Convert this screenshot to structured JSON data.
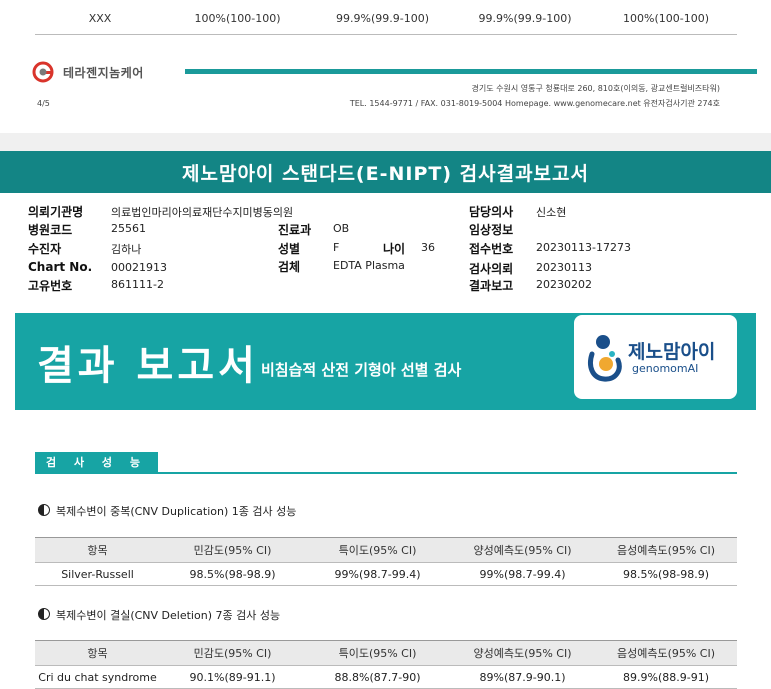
{
  "prev_table": {
    "row_label": "XXX",
    "values": [
      "100%(100-100)",
      "99.9%(99.9-100)",
      "99.9%(99.9-100)",
      "100%(100-100)"
    ]
  },
  "footer": {
    "company": "테라젠지놈케어",
    "address": "경기도 수원시 영통구 청룡대로 260, 810호(이의동, 광교센트럴비즈타워)",
    "contact": "TEL. 1544-9771 / FAX. 031-8019-5004 Homepage. www.genomecare.net 유전자검사기관 274호",
    "page": "4/5",
    "accent": "#1a9a9a"
  },
  "report_title": "제노맘아이 스탠다드(E-NIPT) 검사결과보고서",
  "info": {
    "left": [
      {
        "label": "의뢰기관명",
        "value": "의료법인마리아의료재단수지미병동의원"
      },
      {
        "label": "병원코드",
        "value": "25561"
      },
      {
        "label": "수진자",
        "value": "김하나"
      },
      {
        "label": "Chart No.",
        "value": "00021913"
      },
      {
        "label": "고유번호",
        "value": "861111-2"
      }
    ],
    "mid": [
      {
        "label": "진료과",
        "value": "OB"
      },
      {
        "label": "성별",
        "value": "F"
      },
      {
        "label": "검체",
        "value": "EDTA Plasma"
      }
    ],
    "age": {
      "label": "나이",
      "value": "36"
    },
    "right": [
      {
        "label": "담당의사",
        "value": "신소현"
      },
      {
        "label": "임상정보",
        "value": ""
      },
      {
        "label": "접수번호",
        "value": "20230113-17273"
      },
      {
        "label": "검사의뢰",
        "value": "20230113"
      },
      {
        "label": "결과보고",
        "value": "20230202"
      }
    ]
  },
  "banner": {
    "title": "결과 보고서",
    "subtitle": "비침습적 산전 기형아 선별 검사",
    "logo_ko": "제노맘아이",
    "logo_en": "genomomAI",
    "color": "#17a4a4"
  },
  "section_tab": "검 사 성 능",
  "tables": [
    {
      "heading": "복제수변이 중복(CNV Duplication) 1종 검사 성능",
      "columns": [
        "항목",
        "민감도(95% CI)",
        "특이도(95% CI)",
        "양성예측도(95% CI)",
        "음성예측도(95% CI)"
      ],
      "rows": [
        [
          "Silver-Russell",
          "98.5%(98-98.9)",
          "99%(98.7-99.4)",
          "99%(98.7-99.4)",
          "98.5%(98-98.9)"
        ]
      ]
    },
    {
      "heading": "복제수변이 결실(CNV Deletion) 7종 검사 성능",
      "columns": [
        "항목",
        "민감도(95% CI)",
        "특이도(95% CI)",
        "양성예측도(95% CI)",
        "음성예측도(95% CI)"
      ],
      "rows": [
        [
          "Cri du chat syndrome",
          "90.1%(89-91.1)",
          "88.8%(87.7-90)",
          "89%(87.9-90.1)",
          "89.9%(88.9-91)"
        ]
      ]
    }
  ]
}
